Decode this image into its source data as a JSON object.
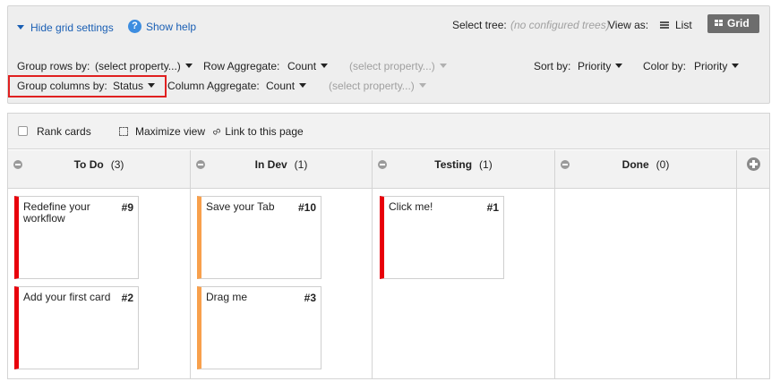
{
  "settings": {
    "hide_label": "Hide grid settings",
    "help_label": "Show help",
    "select_tree_label": "Select tree:",
    "select_tree_value": "(no configured trees)",
    "view_as_label": "View as:",
    "list_label": "List",
    "grid_label": "Grid",
    "group_rows_label": "Group rows by:",
    "group_rows_value": "(select property...)",
    "row_agg_label": "Row Aggregate:",
    "row_agg_value": "Count",
    "row_agg_property": "(select property...)",
    "sort_label": "Sort by:",
    "sort_value": "Priority",
    "color_label": "Color by:",
    "color_value": "Priority",
    "group_cols_label": "Group columns by:",
    "group_cols_value": "Status",
    "col_agg_label": "Column Aggregate:",
    "col_agg_value": "Count",
    "col_agg_property": "(select property...)"
  },
  "toolbar": {
    "rank_label": "Rank cards",
    "maximize_label": "Maximize view",
    "link_label": "Link to this page"
  },
  "columns": [
    {
      "name": "To Do",
      "count": "(3)"
    },
    {
      "name": "In Dev",
      "count": "(1)"
    },
    {
      "name": "Testing",
      "count": "(1)"
    },
    {
      "name": "Done",
      "count": "(0)"
    }
  ],
  "cards": [
    {
      "title": "Redefine your workflow",
      "id": "#9",
      "color": "#e8000b"
    },
    {
      "title": "Add your first card",
      "id": "#2",
      "color": "#e8000b"
    },
    {
      "title": "Save your Tab",
      "id": "#10",
      "color": "#f8a04c"
    },
    {
      "title": "Drag me",
      "id": "#3",
      "color": "#f8a04c"
    },
    {
      "title": "Click me!",
      "id": "#1",
      "color": "#e8000b"
    }
  ],
  "colors": {
    "accent": "#1a5fb4",
    "highlight": "#e02020",
    "grid_button": "#6d6d6d"
  }
}
